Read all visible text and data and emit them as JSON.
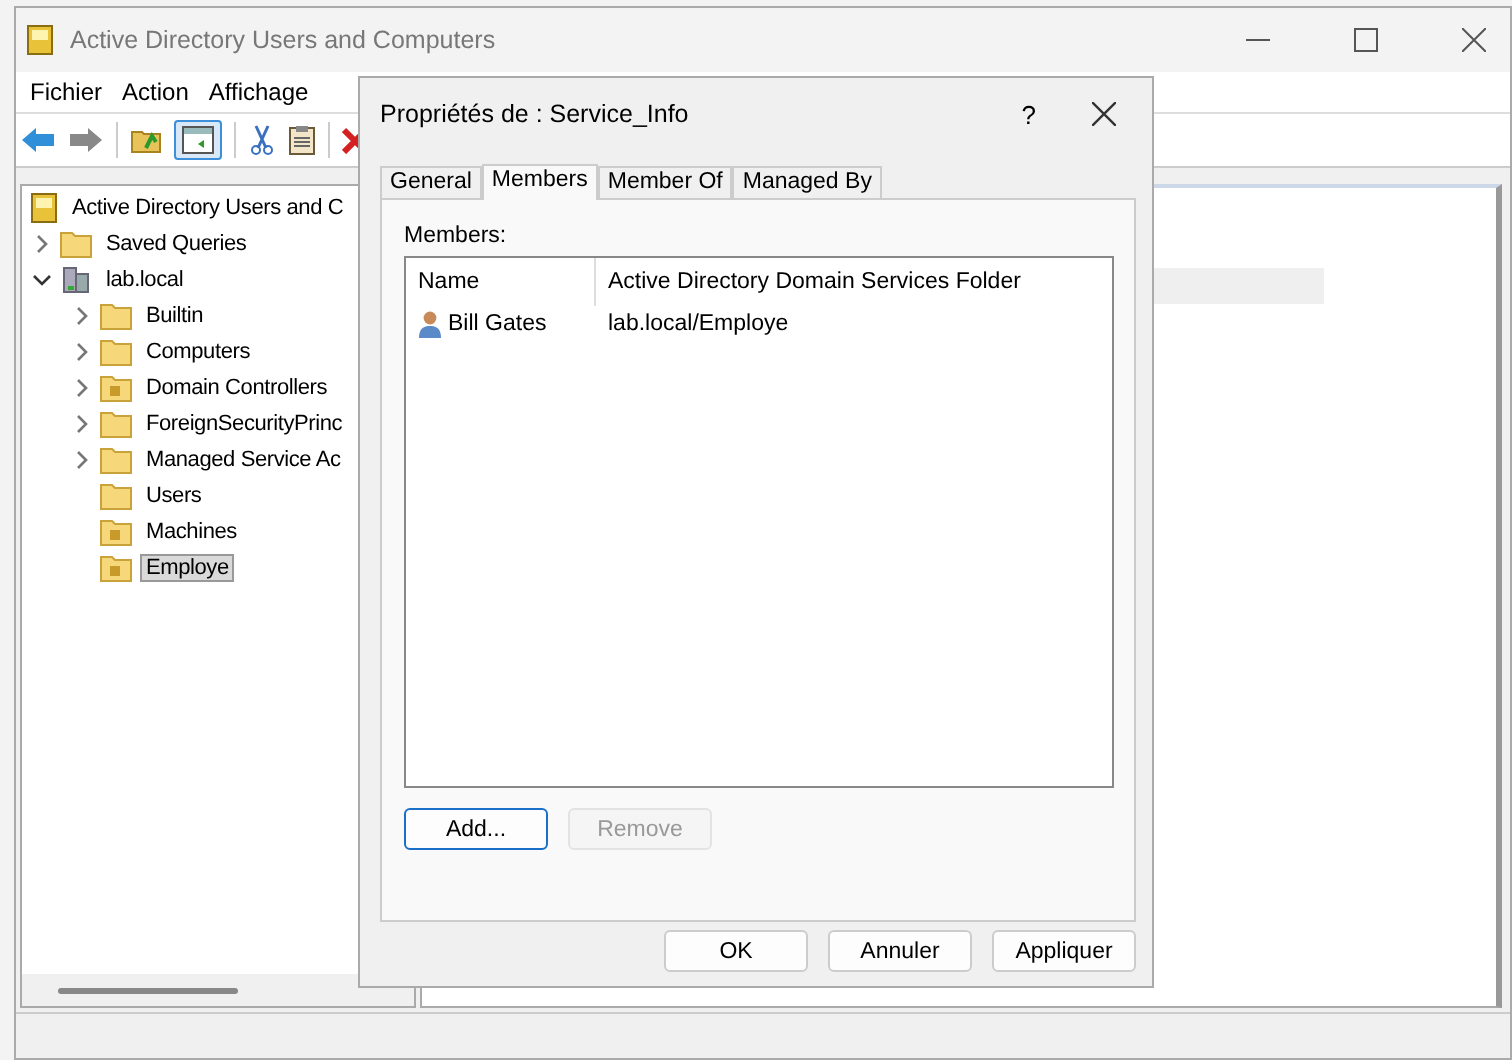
{
  "window": {
    "title": "Active Directory Users and Computers"
  },
  "menu": [
    "Fichier",
    "Action",
    "Affichage"
  ],
  "tree": [
    {
      "label": "Active Directory Users and C",
      "kind": "root",
      "selected": false,
      "children": [
        {
          "label": "Saved Queries",
          "kind": "folder",
          "expanded": false,
          "selected": false
        },
        {
          "label": "lab.local",
          "kind": "domain",
          "expanded": true,
          "selected": false,
          "children": [
            {
              "label": "Builtin",
              "kind": "folder",
              "expanded": false,
              "selected": false
            },
            {
              "label": "Computers",
              "kind": "folder",
              "expanded": false,
              "selected": false
            },
            {
              "label": "Domain Controllers",
              "kind": "ou",
              "expanded": false,
              "selected": false
            },
            {
              "label": "ForeignSecurityPrinc",
              "kind": "folder",
              "expanded": false,
              "selected": false
            },
            {
              "label": "Managed Service Ac",
              "kind": "folder",
              "expanded": false,
              "selected": false
            },
            {
              "label": "Users",
              "kind": "folder",
              "selected": false
            },
            {
              "label": "Machines",
              "kind": "ou",
              "selected": false
            },
            {
              "label": "Employe",
              "kind": "ou",
              "selected": true
            }
          ]
        }
      ]
    }
  ],
  "dialog": {
    "title": "Propriétés de : Service_Info",
    "help": "?",
    "tabs": [
      {
        "label": "General",
        "selected": false
      },
      {
        "label": "Members",
        "selected": true
      },
      {
        "label": "Member Of",
        "selected": false
      },
      {
        "label": "Managed By",
        "selected": false
      }
    ],
    "members_label": "Members:",
    "columns": [
      "Name",
      "Active Directory Domain Services Folder"
    ],
    "rows": [
      {
        "name": "Bill Gates",
        "folder": "lab.local/Employe"
      }
    ],
    "list_buttons": [
      {
        "label": "Add...",
        "disabled": false
      },
      {
        "label": "Remove",
        "disabled": true
      }
    ],
    "buttons": [
      "OK",
      "Annuler",
      "Appliquer"
    ]
  }
}
